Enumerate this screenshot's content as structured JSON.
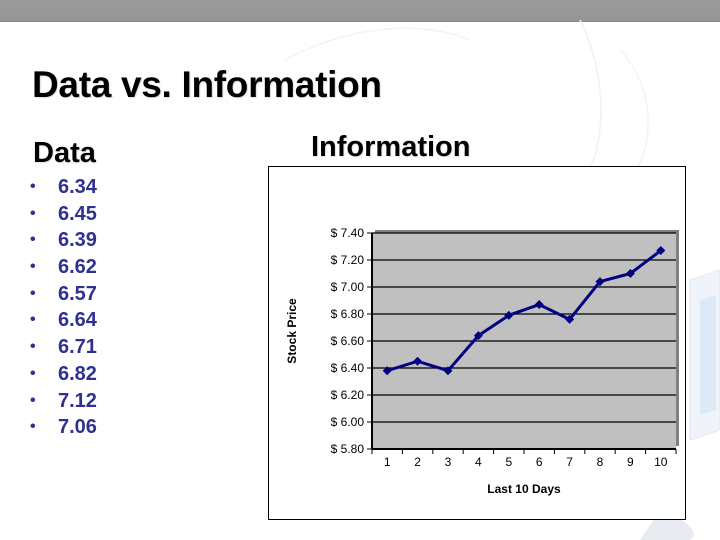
{
  "slide": {
    "title": "Data vs. Information",
    "data_heading": "Data",
    "info_heading": "Information",
    "bullet_glyph": "•",
    "data_values": [
      "6.34",
      "6.45",
      "6.39",
      "6.62",
      "6.57",
      "6.64",
      "6.71",
      "6.82",
      "7.12",
      "7.06"
    ]
  },
  "colors": {
    "topbar": "#9a9a9a",
    "bullet_text": "#2e3192",
    "plot_background": "#c0c0c0",
    "series_line": "#000080"
  },
  "chart_data": {
    "type": "line",
    "title": "",
    "xlabel": "Last 10 Days",
    "ylabel": "Stock Price",
    "x": [
      1,
      2,
      3,
      4,
      5,
      6,
      7,
      8,
      9,
      10
    ],
    "x_tick_labels": [
      "1",
      "2",
      "3",
      "4",
      "5",
      "6",
      "7",
      "8",
      "9",
      "10"
    ],
    "y_tick_labels": [
      "$ 5.80",
      "$ 6.00",
      "$ 6.20",
      "$ 6.40",
      "$ 6.60",
      "$ 6.80",
      "$ 7.00",
      "$ 7.20",
      "$ 7.40"
    ],
    "y_ticks": [
      5.8,
      6.0,
      6.2,
      6.4,
      6.6,
      6.8,
      7.0,
      7.2,
      7.4
    ],
    "ylim": [
      5.8,
      7.4
    ],
    "grid": true,
    "legend": "none",
    "marker": "diamond",
    "series": [
      {
        "name": "Stock Price",
        "values": [
          6.38,
          6.45,
          6.38,
          6.64,
          6.79,
          6.87,
          6.76,
          7.04,
          7.1,
          7.27
        ]
      }
    ]
  }
}
